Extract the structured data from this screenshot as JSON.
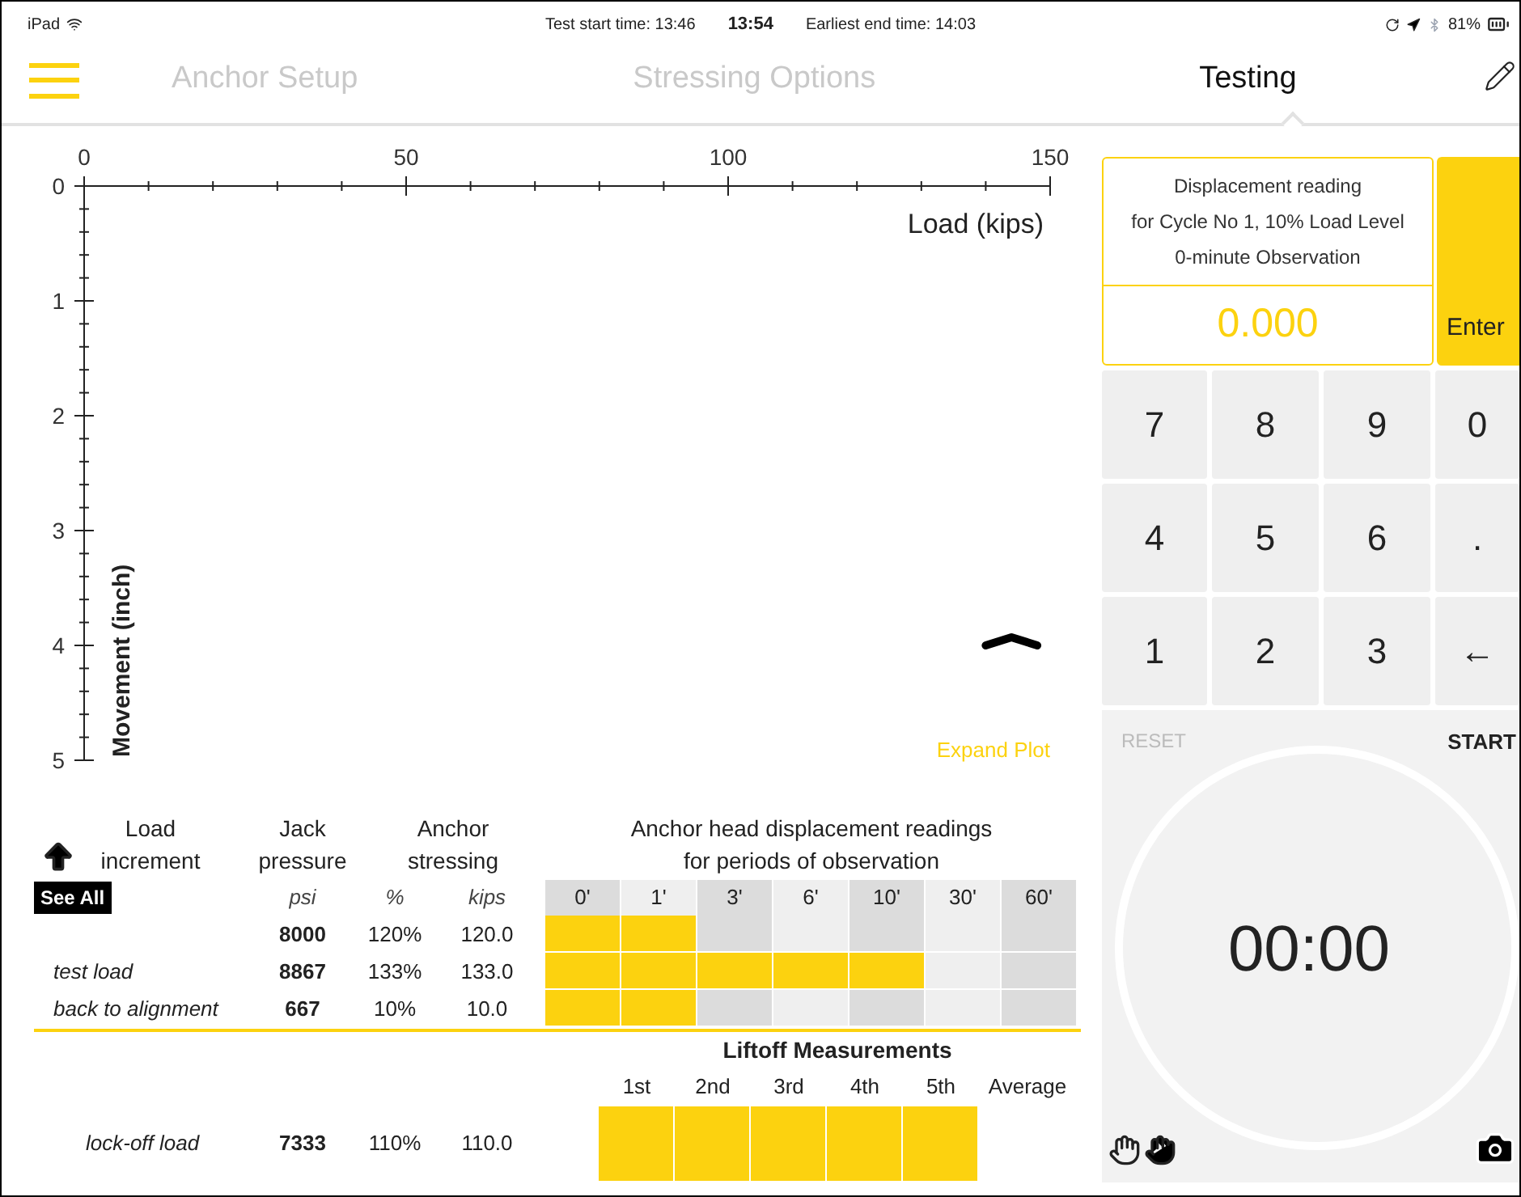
{
  "status_bar": {
    "device": "iPad",
    "test_start": "Test start time: 13:46",
    "clock": "13:54",
    "earliest_end": "Earliest end time: 14:03",
    "battery": "81%"
  },
  "tabs": [
    {
      "label": "Anchor Setup",
      "selected": false
    },
    {
      "label": "Stressing Options",
      "selected": false
    },
    {
      "label": "Testing",
      "selected": true
    }
  ],
  "plot": {
    "expand_label": "Expand Plot",
    "chart_data": {
      "type": "line",
      "xlabel": "Load (kips)",
      "ylabel": "Movement (inch)",
      "xlim": [
        0,
        150
      ],
      "ylim": [
        5,
        0
      ],
      "xticks": [
        0,
        50,
        100,
        150
      ],
      "yticks": [
        0,
        1,
        2,
        3,
        4,
        5
      ],
      "x": [
        140,
        144,
        148
      ],
      "series": [
        {
          "color": "#000000",
          "values": [
            4.0,
            3.93,
            4.0
          ]
        }
      ]
    }
  },
  "table": {
    "see_all": "See All",
    "headers": [
      "Load increment",
      "Jack pressure",
      "Anchor stressing",
      "Anchor head displacement readings for periods of observation"
    ],
    "units": [
      "psi",
      "%",
      "kips"
    ],
    "periods": [
      "0'",
      "1'",
      "3'",
      "6'",
      "10'",
      "30'",
      "60'"
    ],
    "rows": [
      {
        "pressure": "8000",
        "percent": "120%",
        "kips": "120.0",
        "readings": [
          {
            "filled": true
          },
          {
            "filled": true
          },
          {
            "filled": false
          },
          {
            "filled": false
          },
          {
            "filled": false
          },
          {
            "filled": false
          },
          {
            "filled": false
          }
        ]
      },
      {
        "label": "test load",
        "pressure": "8867",
        "percent": "133%",
        "kips": "133.0",
        "readings": [
          {
            "filled": true
          },
          {
            "filled": true
          },
          {
            "filled": true
          },
          {
            "filled": true
          },
          {
            "filled": true
          },
          {
            "filled": false
          },
          {
            "filled": false
          }
        ]
      },
      {
        "label": "back to alignment",
        "pressure": "667",
        "percent": "10%",
        "kips": "10.0",
        "readings": [
          {
            "filled": true
          },
          {
            "filled": true
          },
          {
            "filled": false
          },
          {
            "filled": false
          },
          {
            "filled": false
          },
          {
            "filled": false
          },
          {
            "filled": false
          }
        ]
      }
    ]
  },
  "liftoff": {
    "title": "Liftoff Measurements",
    "columns": [
      "1st",
      "2nd",
      "3rd",
      "4th",
      "5th",
      "Average"
    ],
    "row": {
      "label": "lock-off load",
      "pressure": "7333",
      "percent": "110%",
      "kips": "110.0",
      "cells": [
        {
          "filled": true
        },
        {
          "filled": true
        },
        {
          "filled": true
        },
        {
          "filled": true
        },
        {
          "filled": true
        }
      ]
    }
  },
  "entry": {
    "prompt": [
      "Displacement reading",
      "for Cycle No 1, 10% Load Level",
      "0-minute Observation"
    ],
    "value": "0.000",
    "enter": "Enter"
  },
  "keypad": [
    "7",
    "8",
    "9",
    "0",
    "4",
    "5",
    "6",
    ".",
    "1",
    "2",
    "3",
    "←"
  ],
  "timer": {
    "reset": "RESET",
    "start": "START",
    "time": "00:00"
  }
}
